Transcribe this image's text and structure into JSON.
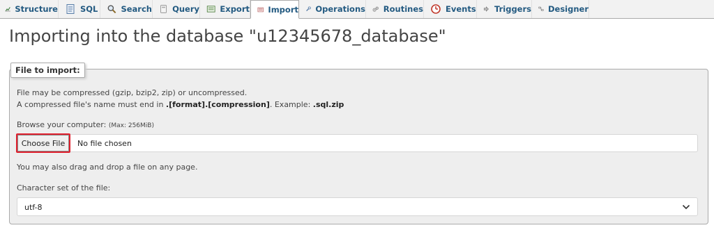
{
  "tabs": [
    {
      "id": "structure",
      "label": "Structure",
      "icon": "structure-icon"
    },
    {
      "id": "sql",
      "label": "SQL",
      "icon": "sql-icon"
    },
    {
      "id": "search",
      "label": "Search",
      "icon": "search-icon"
    },
    {
      "id": "query",
      "label": "Query",
      "icon": "query-icon"
    },
    {
      "id": "export",
      "label": "Export",
      "icon": "export-icon"
    },
    {
      "id": "import",
      "label": "Import",
      "icon": "import-icon",
      "active": true
    },
    {
      "id": "operations",
      "label": "Operations",
      "icon": "wrench-icon"
    },
    {
      "id": "routines",
      "label": "Routines",
      "icon": "routines-icon"
    },
    {
      "id": "events",
      "label": "Events",
      "icon": "events-icon"
    },
    {
      "id": "triggers",
      "label": "Triggers",
      "icon": "triggers-icon"
    },
    {
      "id": "designer",
      "label": "Designer",
      "icon": "designer-icon"
    }
  ],
  "page": {
    "title": "Importing into the database \"u12345678_database\""
  },
  "import_form": {
    "legend": "File to import:",
    "compression_note": "File may be compressed (gzip, bzip2, zip) or uncompressed.",
    "name_note_prefix": "A compressed file's name must end in ",
    "name_note_format": ".[format].[compression]",
    "name_note_mid": ". Example: ",
    "name_note_example": ".sql.zip",
    "browse_label": "Browse your computer: ",
    "browse_max": "(Max: 256MiB)",
    "choose_file_button": "Choose File",
    "file_status": "No file chosen",
    "drag_note": "You may also drag and drop a file on any page.",
    "charset_label": "Character set of the file:",
    "charset_value": "utf-8"
  },
  "colors": {
    "tab_text": "#235a81",
    "highlight": "#e0202e",
    "fieldset_bg": "#eeeeee"
  }
}
